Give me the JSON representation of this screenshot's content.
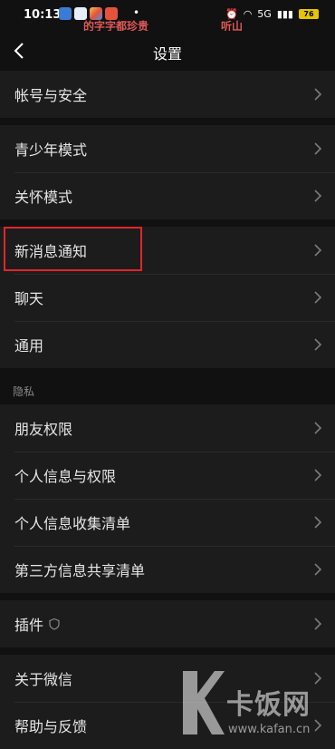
{
  "status": {
    "time": "10:13",
    "dot": "•",
    "overlay_left": "的字字都珍贵",
    "overlay_right": "听山",
    "network": "5G",
    "battery": "76"
  },
  "header": {
    "title": "设置"
  },
  "groups": {
    "account": {
      "items": [
        "帐号与安全"
      ]
    },
    "modes": {
      "items": [
        "青少年模式",
        "关怀模式"
      ]
    },
    "general": {
      "items": [
        "新消息通知",
        "聊天",
        "通用"
      ]
    },
    "privacy": {
      "label": "隐私",
      "items": [
        "朋友权限",
        "个人信息与权限",
        "个人信息收集清单",
        "第三方信息共享清单"
      ]
    },
    "plugins": {
      "items": [
        "插件"
      ]
    },
    "about": {
      "items": [
        "关于微信",
        "帮助与反馈"
      ]
    }
  },
  "watermark": {
    "brand": "卡饭网",
    "url": "www.kafan.cn"
  },
  "colors": {
    "background": "#111111",
    "row": "#1c1c1c",
    "highlight": "#e0262b"
  }
}
